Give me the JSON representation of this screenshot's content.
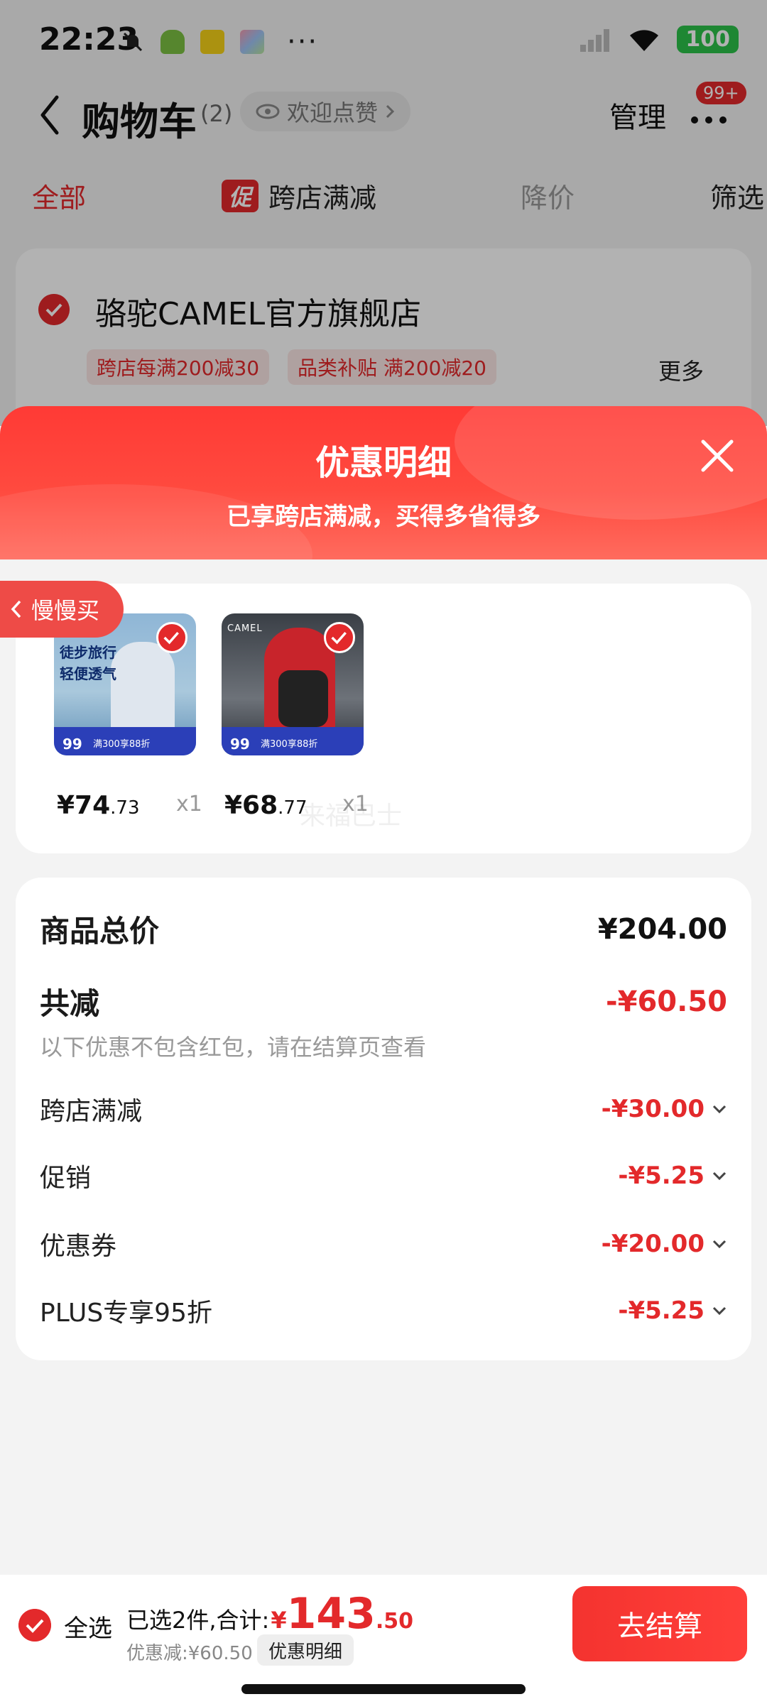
{
  "status_bar": {
    "time": "22:23",
    "more": "···",
    "battery": "100"
  },
  "nav": {
    "title": "购物车",
    "count": "(2)",
    "like_label": "欢迎点赞",
    "manage": "管理",
    "badge": "99+"
  },
  "tabs": {
    "all": "全部",
    "promo_tag": "促",
    "promo": "跨店满减",
    "price_drop": "降价",
    "filter": "筛选"
  },
  "shop": {
    "name": "骆驼CAMEL官方旗舰店",
    "tag1": "跨店每满200减30",
    "tag2": "品类补贴 满200减20",
    "more": "更多"
  },
  "sheet": {
    "title": "优惠明细",
    "subtitle": "已享跨店满减，买得多省得多",
    "slow_buy": "慢慢买",
    "watermark": "来福巴士"
  },
  "products": [
    {
      "price_int": "¥74",
      "price_dec": ".73",
      "qty": "x1",
      "img_text1": "徒步旅行",
      "img_text2": "轻便透气",
      "strip_price": "99",
      "strip_deal": "满300享88折"
    },
    {
      "price_int": "¥68",
      "price_dec": ".77",
      "qty": "x1",
      "img_brand": "CAMEL",
      "strip_price": "99",
      "strip_deal": "满300享88折"
    }
  ],
  "summary": {
    "total_label": "商品总价",
    "total_value": "¥204.00",
    "reduce_label": "共减",
    "reduce_value": "-¥60.50",
    "note": "以下优惠不包含红包，请在结算页查看",
    "details": [
      {
        "label": "跨店满减",
        "value": "-¥30.00"
      },
      {
        "label": "促销",
        "value": "-¥5.25"
      },
      {
        "label": "优惠券",
        "value": "-¥20.00"
      },
      {
        "label": "PLUS专享95折",
        "value": "-¥5.25"
      }
    ]
  },
  "bottom": {
    "select_all": "全选",
    "selected_text": "已选2件,合计:",
    "currency": "¥",
    "total_int": "143",
    "total_dec": ".50",
    "discount_text": "优惠减:¥60.50",
    "discount_button": "优惠明细",
    "checkout": "去结算"
  },
  "colors": {
    "accent": "#e3292b",
    "header_red": "#ff3a35",
    "page_bg": "#f3f3f3"
  }
}
